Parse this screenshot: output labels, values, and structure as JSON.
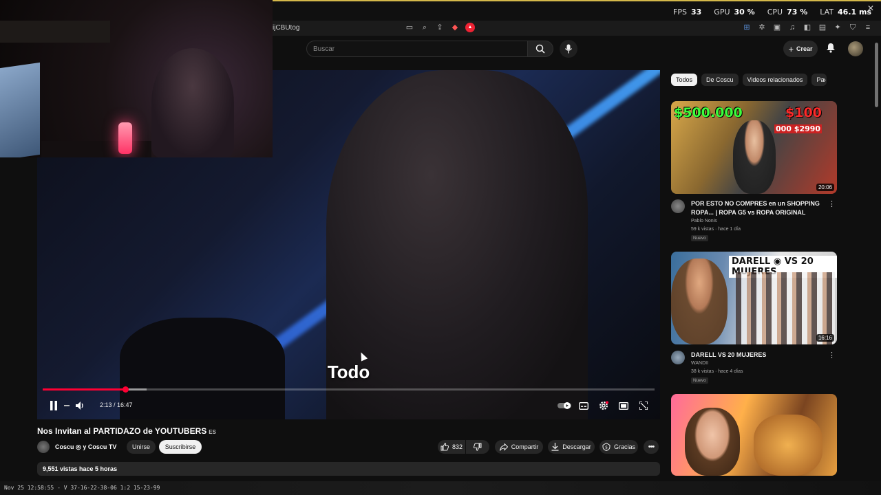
{
  "perf": {
    "fps_label": "FPS",
    "fps": "33",
    "gpu_label": "GPU",
    "gpu": "30 %",
    "cpu_label": "CPU",
    "cpu": "73 %",
    "lat_label": "LAT",
    "lat": "46.1 ms"
  },
  "browser": {
    "url_fragment": "ijCBUtog"
  },
  "header": {
    "search_placeholder": "Buscar",
    "create_label": "Crear"
  },
  "player": {
    "caption": "Todo",
    "time": "2:13 / 16:47",
    "progress_played": 0.135,
    "progress_buffered": 0.17
  },
  "video": {
    "title": "Nos Invitan al PARTIDAZO de YOUTUBERS",
    "lang_badge": "ES",
    "channel": "Coscu ◎ y Coscu TV",
    "join_label": "Unirse",
    "subscribe_label": "Suscribirse",
    "likes": "832",
    "share_label": "Compartir",
    "download_label": "Descargar",
    "thanks_label": "Gracias",
    "description": "9,551 vistas  hace 5 horas"
  },
  "sidebar": {
    "chips": [
      "Todos",
      "De Coscu",
      "Videos relacionados",
      "Pa"
    ],
    "videos": [
      {
        "thumb_text_left": "$500.000",
        "thumb_text_right": "$100",
        "thumb_sub": "000 $2990",
        "duration": "20:06",
        "title": "POR ESTO NO COMPRES en un SHOPPING ROPA... | ROPA G5 vs ROPA ORIGINAL",
        "channel": "Pablo Nonis",
        "stats": "59 k vistas · hace 1 día",
        "badge": "Nuevo"
      },
      {
        "thumb_text": "DARELL ◉ VS 20 MUJERES",
        "duration": "16:16",
        "title": "DARELL VS 20 MUJERES",
        "channel": "WANDII",
        "stats": "38 k vistas · hace 4 días",
        "badge": "Nuevo"
      }
    ]
  },
  "status_bar": {
    "text": "Nov 25 12:58:55 - V 37-16-22-38-06 1:2 15-23-99"
  },
  "colors": {
    "accent_red": "#ff0033",
    "bg": "#0f0f0f",
    "chip_bg": "#272727"
  }
}
